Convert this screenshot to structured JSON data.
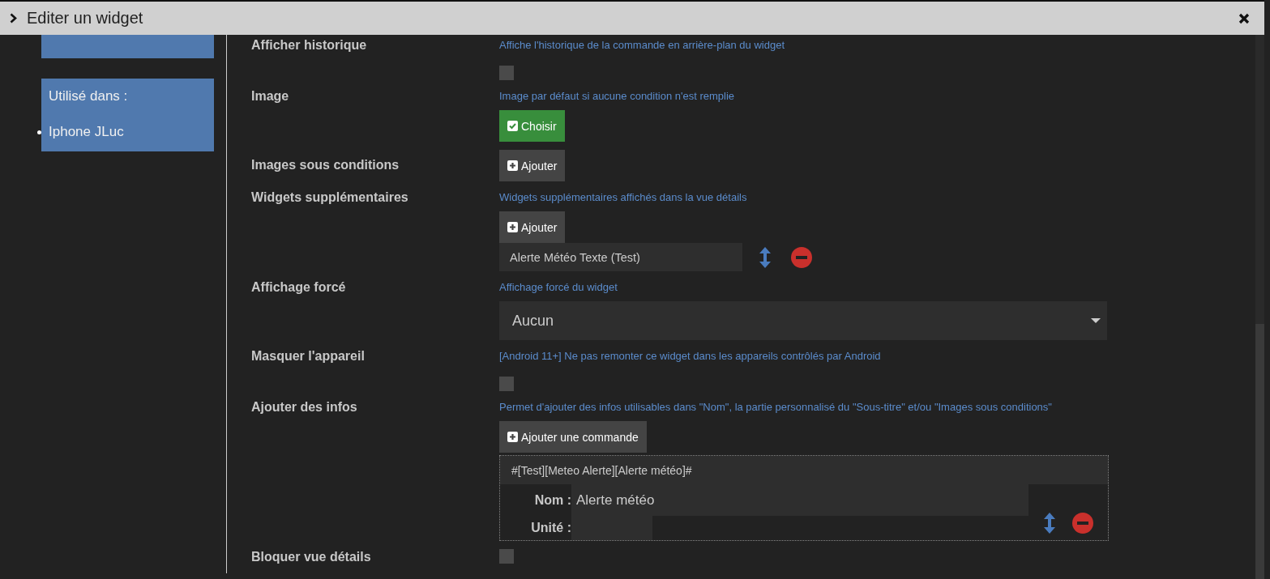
{
  "dialog": {
    "title": "Editer un widget"
  },
  "sidebar": {
    "used_in_label": "Utilisé dans :",
    "used_in": [
      "Iphone JLuc"
    ]
  },
  "rows": [
    {
      "kind": "checkbox",
      "label": "Afficher historique",
      "hint": "Affiche l'historique de la commande en arrière-plan du widget",
      "checked": false
    },
    {
      "kind": "choose",
      "label": "Image",
      "hint": "Image par défaut si aucune condition n'est remplie",
      "button": "Choisir"
    },
    {
      "kind": "add",
      "label": "Images sous conditions",
      "button": "Ajouter",
      "items": []
    },
    {
      "kind": "add",
      "label": "Widgets supplémentaires",
      "hint": "Widgets supplémentaires affichés dans la vue détails",
      "button": "Ajouter",
      "items": [
        "Alerte Météo Texte (Test)"
      ]
    },
    {
      "kind": "select",
      "label": "Affichage forcé",
      "hint": "Affichage forcé du widget",
      "value": "Aucun"
    },
    {
      "kind": "checkbox",
      "label": "Masquer l'appareil",
      "hint": "[Android 11+] Ne pas remonter ce widget dans les appareils contrôlés par Android",
      "checked": false
    },
    {
      "kind": "infos",
      "label": "Ajouter des infos",
      "hint": "Permet d'ajouter des infos utilisables dans \"Nom\", la partie personnalisé du \"Sous-titre\" et/ou \"Images sous conditions\"",
      "button": "Ajouter une commande",
      "commands": [
        {
          "path": "#[Test][Meteo Alerte][Alerte météo]#",
          "name_label": "Nom :",
          "name": "Alerte météo",
          "unit_label": "Unité :"
        }
      ]
    },
    {
      "kind": "checkbox",
      "label": "Bloquer vue détails",
      "checked": false
    }
  ]
}
